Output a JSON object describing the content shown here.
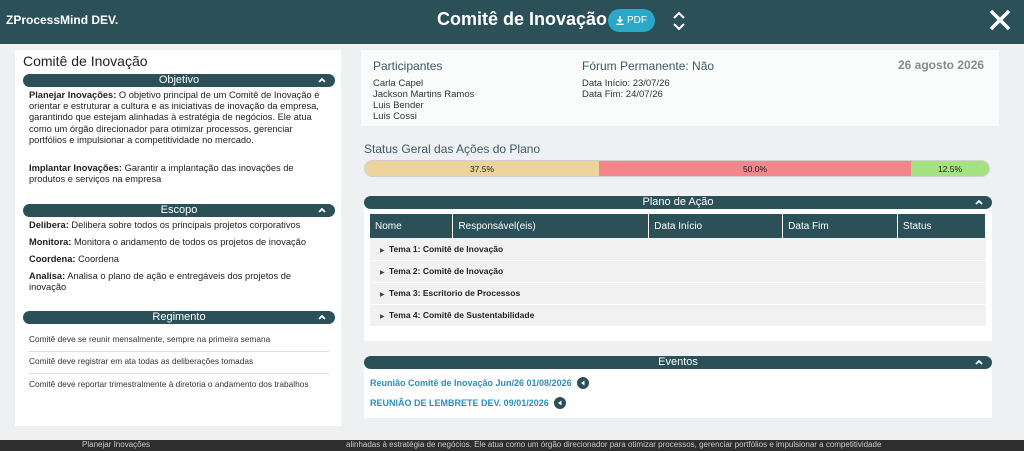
{
  "header": {
    "brand": "ZProcessMind DEV.",
    "title": "Comitê de Inovação",
    "pdf_label": "PDF"
  },
  "left": {
    "title": "Comitê de Inovação",
    "objetivo": {
      "header": "Objetivo",
      "items": [
        {
          "label": "Planejar Inovações:",
          "text": " O objetivo principal de um Comitê de Inovação é orientar e estruturar a cultura e as iniciativas de inovação da empresa, garantindo que estejam alinhadas à estratégia de negócios. Ele atua como um órgão direcionador para otimizar processos, gerenciar portfólios e impulsionar a competitividade no mercado."
        },
        {
          "label": "Implantar Inovações:",
          "text": " Garantir a implantação das inovações de produtos e serviços na empresa"
        }
      ]
    },
    "escopo": {
      "header": "Escopo",
      "items": [
        {
          "label": "Delibera:",
          "text": " Delibera sobre todos os principais projetos corporativos"
        },
        {
          "label": "Monitora:",
          "text": " Monitora o andamento de todos os projetos de inovação"
        },
        {
          "label": "Coordena:",
          "text": " Coordena"
        },
        {
          "label": "Analisa:",
          "text": " Analisa o plano de ação e entregáveis dos projetos de inovação"
        }
      ]
    },
    "regimento": {
      "header": "Regimento",
      "items": [
        "Comitê deve se reunir mensalmente, sempre na primeira semana",
        "Comitê deve registrar em ata todas as deliberações tomadas",
        "Comitê deve reportar trimestralmente à diretoria o andamento dos trabalhos"
      ]
    }
  },
  "right": {
    "participantes": {
      "header": "Participantes",
      "names": [
        "Carla Capel",
        "Jackson Martins Ramos",
        "Luis Bender",
        "Luis Cossi"
      ]
    },
    "forum": {
      "header": "Fórum Permanente: Não",
      "data_inicio": "Data Início: 23/07/26",
      "data_fim": "Data Fim: 24/07/26"
    },
    "date": "26 agosto 2026",
    "status": {
      "title": "Status Geral das Ações do Plano",
      "segments": [
        {
          "label": "37.5%",
          "value": 37.5,
          "color": "#ecd29b"
        },
        {
          "label": "50.0%",
          "value": 50.0,
          "color": "#f2868a"
        },
        {
          "label": "12.5%",
          "value": 12.5,
          "color": "#a4e27f"
        }
      ]
    },
    "plano": {
      "header": "Plano de Ação",
      "columns": [
        "Nome",
        "Responsável(eis)",
        "Data Início",
        "Data Fim",
        "Status"
      ],
      "rows": [
        "Tema 1: Comitê de Inovação",
        "Tema 2: Comitê de Inovação",
        "Tema 3: Escritorio de Processos",
        "Tema 4: Comitê de Sustentabilidade"
      ]
    },
    "eventos": {
      "header": "Eventos",
      "items": [
        "Reunião Comitê de Inovação Jun/26 01/08/2026",
        "REUNIÃO DE LEMBRETE DEV. 09/01/2026"
      ]
    }
  },
  "footer": {
    "left": "Planejar Inovações",
    "right": "alinhadas à estratégia de negócios. Ele atua como um órgão direcionador para otimizar processos, gerenciar portfólios e impulsionar a competitividade"
  }
}
